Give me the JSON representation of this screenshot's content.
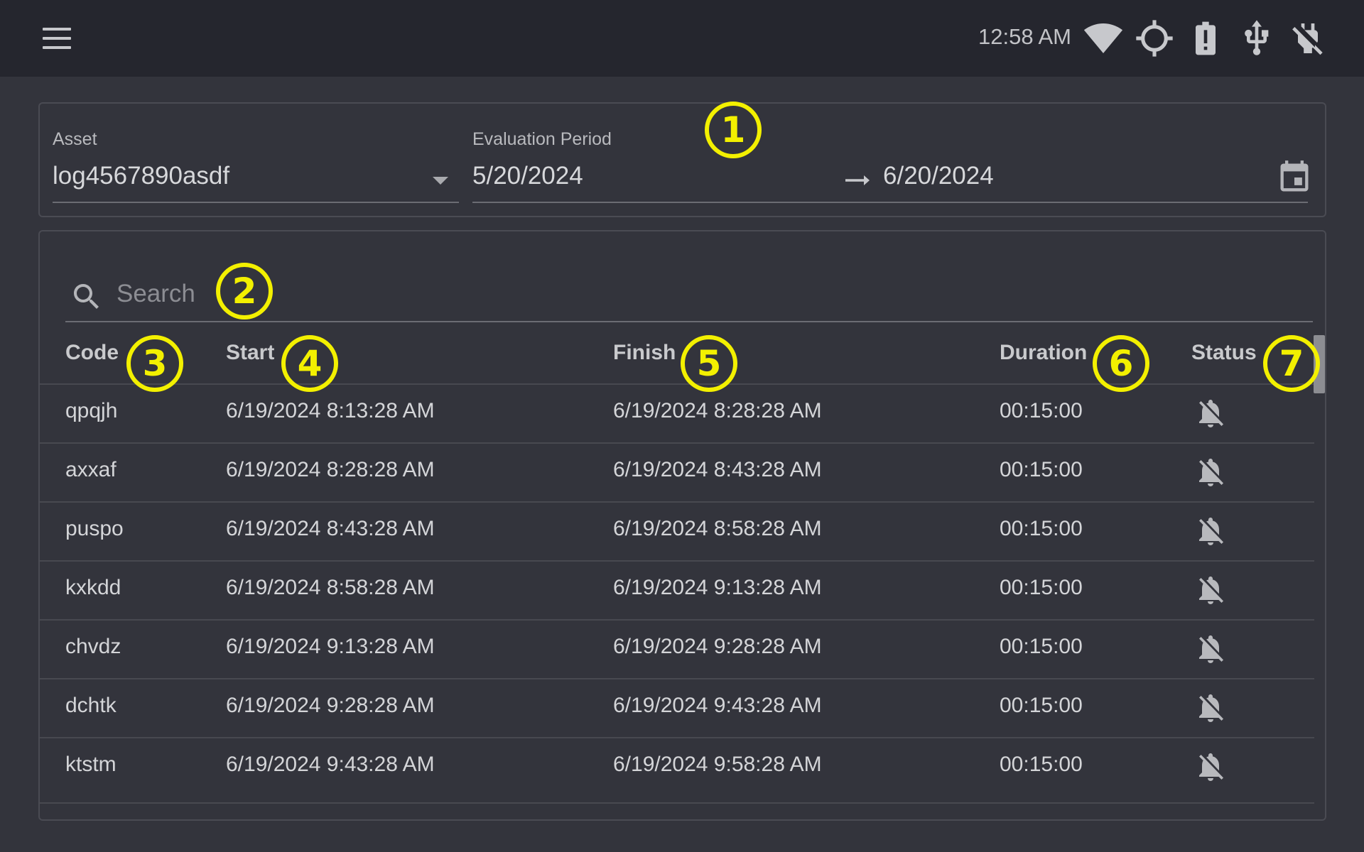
{
  "topbar": {
    "clock": "12:58 AM",
    "icons": [
      "menu-icon",
      "wifi-icon",
      "gps-icon",
      "battery-alert-icon",
      "usb-icon",
      "power-off-icon"
    ]
  },
  "filters": {
    "asset": {
      "label": "Asset",
      "value": "log4567890asdf"
    },
    "period": {
      "label": "Evaluation Period",
      "start": "5/20/2024",
      "end": "6/20/2024"
    }
  },
  "search": {
    "placeholder": "Search"
  },
  "table": {
    "columns": [
      "Code",
      "Start",
      "Finish",
      "Duration",
      "Status"
    ],
    "rows": [
      {
        "code": "qpqjh",
        "start": "6/19/2024 8:13:28 AM",
        "finish": "6/19/2024 8:28:28 AM",
        "duration": "00:15:00",
        "status": "notifications-off-icon"
      },
      {
        "code": "axxaf",
        "start": "6/19/2024 8:28:28 AM",
        "finish": "6/19/2024 8:43:28 AM",
        "duration": "00:15:00",
        "status": "notifications-off-icon"
      },
      {
        "code": "puspo",
        "start": "6/19/2024 8:43:28 AM",
        "finish": "6/19/2024 8:58:28 AM",
        "duration": "00:15:00",
        "status": "notifications-off-icon"
      },
      {
        "code": "kxkdd",
        "start": "6/19/2024 8:58:28 AM",
        "finish": "6/19/2024 9:13:28 AM",
        "duration": "00:15:00",
        "status": "notifications-off-icon"
      },
      {
        "code": "chvdz",
        "start": "6/19/2024 9:13:28 AM",
        "finish": "6/19/2024 9:28:28 AM",
        "duration": "00:15:00",
        "status": "notifications-off-icon"
      },
      {
        "code": "dchtk",
        "start": "6/19/2024 9:28:28 AM",
        "finish": "6/19/2024 9:43:28 AM",
        "duration": "00:15:00",
        "status": "notifications-off-icon"
      },
      {
        "code": "ktstm",
        "start": "6/19/2024 9:43:28 AM",
        "finish": "6/19/2024 9:58:28 AM",
        "duration": "00:15:00",
        "status": "notifications-off-icon"
      }
    ]
  },
  "annotations": [
    "1",
    "2",
    "3",
    "4",
    "5",
    "6",
    "7"
  ],
  "colors": {
    "background": "#33343c",
    "topbar": "#25262e",
    "badge": "#f3f000"
  }
}
